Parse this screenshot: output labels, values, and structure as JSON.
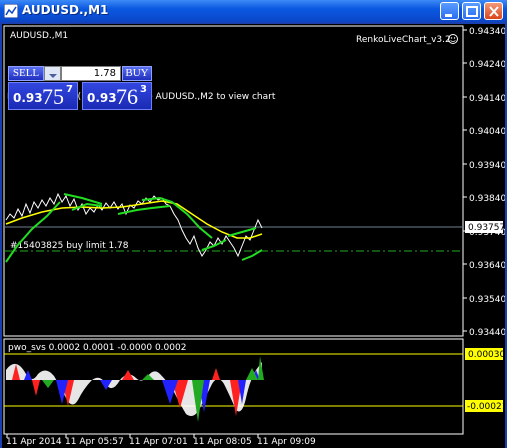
{
  "window": {
    "title": "AUDUSD.,M1",
    "icon": "chart-window-icon",
    "buttons": [
      "minimize-icon",
      "maximize-icon",
      "close-icon"
    ]
  },
  "chart": {
    "symbol_label": "AUDUSD.,M1",
    "indicator_label": "RenkoLiveChart_v3.2",
    "info_text": "RenkoLiveChart(1): Open Offline AUDUSD.,M2 to view chart",
    "order_label": "#15403825 buy limit 1.78",
    "current_price": "0.93757",
    "price_ticks": [
      "0.94340",
      "0.94240",
      "0.94140",
      "0.94040",
      "0.93940",
      "0.93840",
      "0.93740",
      "0.93640",
      "0.93540",
      "0.93440"
    ]
  },
  "trade_panel": {
    "sell_label": "SELL",
    "buy_label": "BUY",
    "quantity": "1.78",
    "sell_price_prefix": "0.93",
    "sell_price_big": "75",
    "sell_price_sup": "7",
    "buy_price_prefix": "0.93",
    "buy_price_big": "76",
    "buy_price_sup": "3"
  },
  "subwindow": {
    "indicator_label": "pwo_svs 0.0002 0.0001 -0.0000 0.0002",
    "level_high": "0.00030",
    "level_low": "-0.00021"
  },
  "time_axis": [
    "11 Apr 2014",
    "11 Apr 05:57",
    "11 Apr 07:01",
    "11 Apr 08:05",
    "11 Apr 09:09"
  ],
  "colors": {
    "price": "#ffffff",
    "ma_green": "#22dd22",
    "ma_yellow": "#ffff00",
    "hist_blue": "#2222ff",
    "hist_red": "#ff2020",
    "hist_green": "#22aa22",
    "hist_white": "#ffffff"
  }
}
